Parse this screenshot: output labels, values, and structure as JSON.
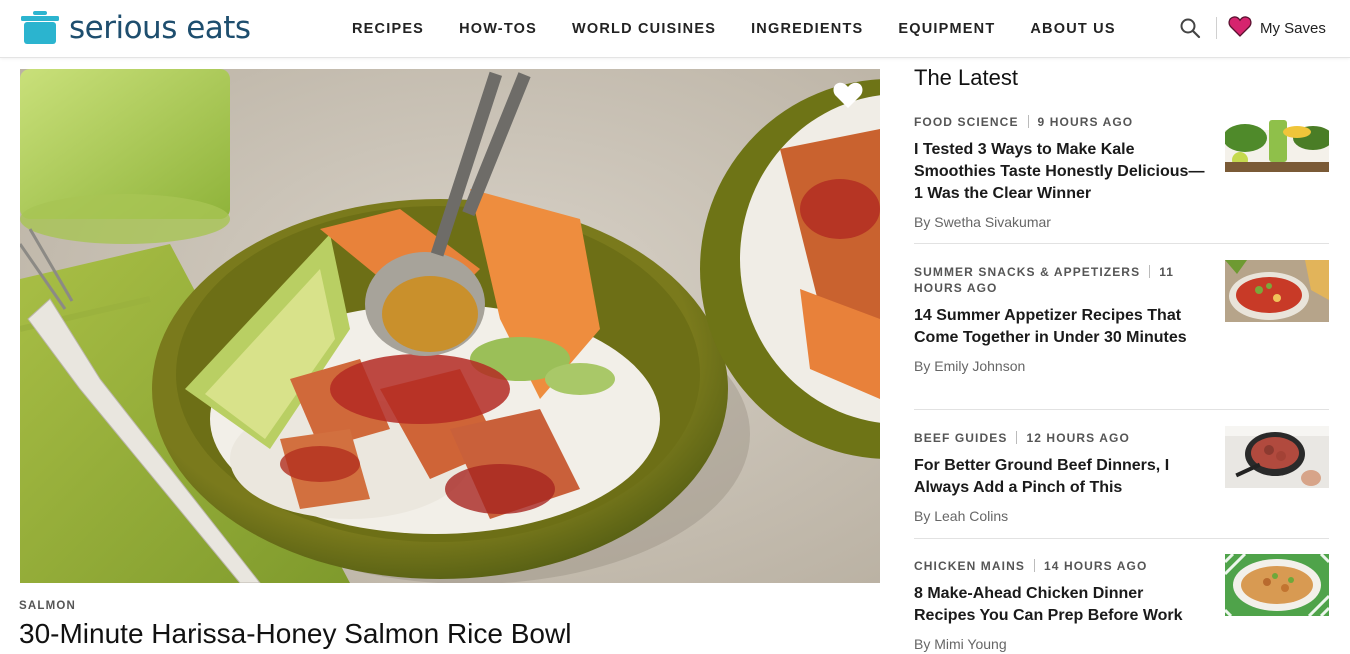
{
  "brand": {
    "name": "serious eats",
    "logo_color": "#1e4e6e",
    "pot_color": "#2bb4cf"
  },
  "nav": {
    "items": [
      {
        "label": "RECIPES"
      },
      {
        "label": "HOW-TOS"
      },
      {
        "label": "WORLD CUISINES"
      },
      {
        "label": "INGREDIENTS"
      },
      {
        "label": "EQUIPMENT"
      },
      {
        "label": "ABOUT US"
      }
    ],
    "search_icon": "search-icon",
    "saves_label": "My Saves",
    "saves_icon": "heart-icon",
    "saves_icon_color": "#d6246e"
  },
  "hero": {
    "category": "SALMON",
    "title": "30-Minute Harissa-Honey Salmon Rice Bowl",
    "image": "salmon-rice-bowl-photo",
    "save_icon": "heart-icon"
  },
  "latest": {
    "heading": "The Latest",
    "items": [
      {
        "category": "FOOD SCIENCE",
        "time": "9 HOURS AGO",
        "title": "I Tested 3 Ways to Make Kale Smoothies Taste Honestly Delicious—1 Was the Clear Winner",
        "author": "By Swetha Sivakumar",
        "thumb": "kale-smoothie-photo"
      },
      {
        "category": "SUMMER SNACKS & APPETIZERS",
        "time": "11 HOURS AGO",
        "title": "14 Summer Appetizer Recipes That Come Together in Under 30 Minutes",
        "author": "By Emily Johnson",
        "thumb": "appetizer-salsa-photo"
      },
      {
        "category": "BEEF GUIDES",
        "time": "12 HOURS AGO",
        "title": "For Better Ground Beef Dinners, I Always Add a Pinch of This",
        "author": "By Leah Colins",
        "thumb": "ground-beef-skillet-photo"
      },
      {
        "category": "CHICKEN MAINS",
        "time": "14 HOURS AGO",
        "title": "8 Make-Ahead Chicken Dinner Recipes You Can Prep Before Work",
        "author": "By Mimi Young",
        "thumb": "chicken-noodle-platter-photo"
      }
    ]
  }
}
